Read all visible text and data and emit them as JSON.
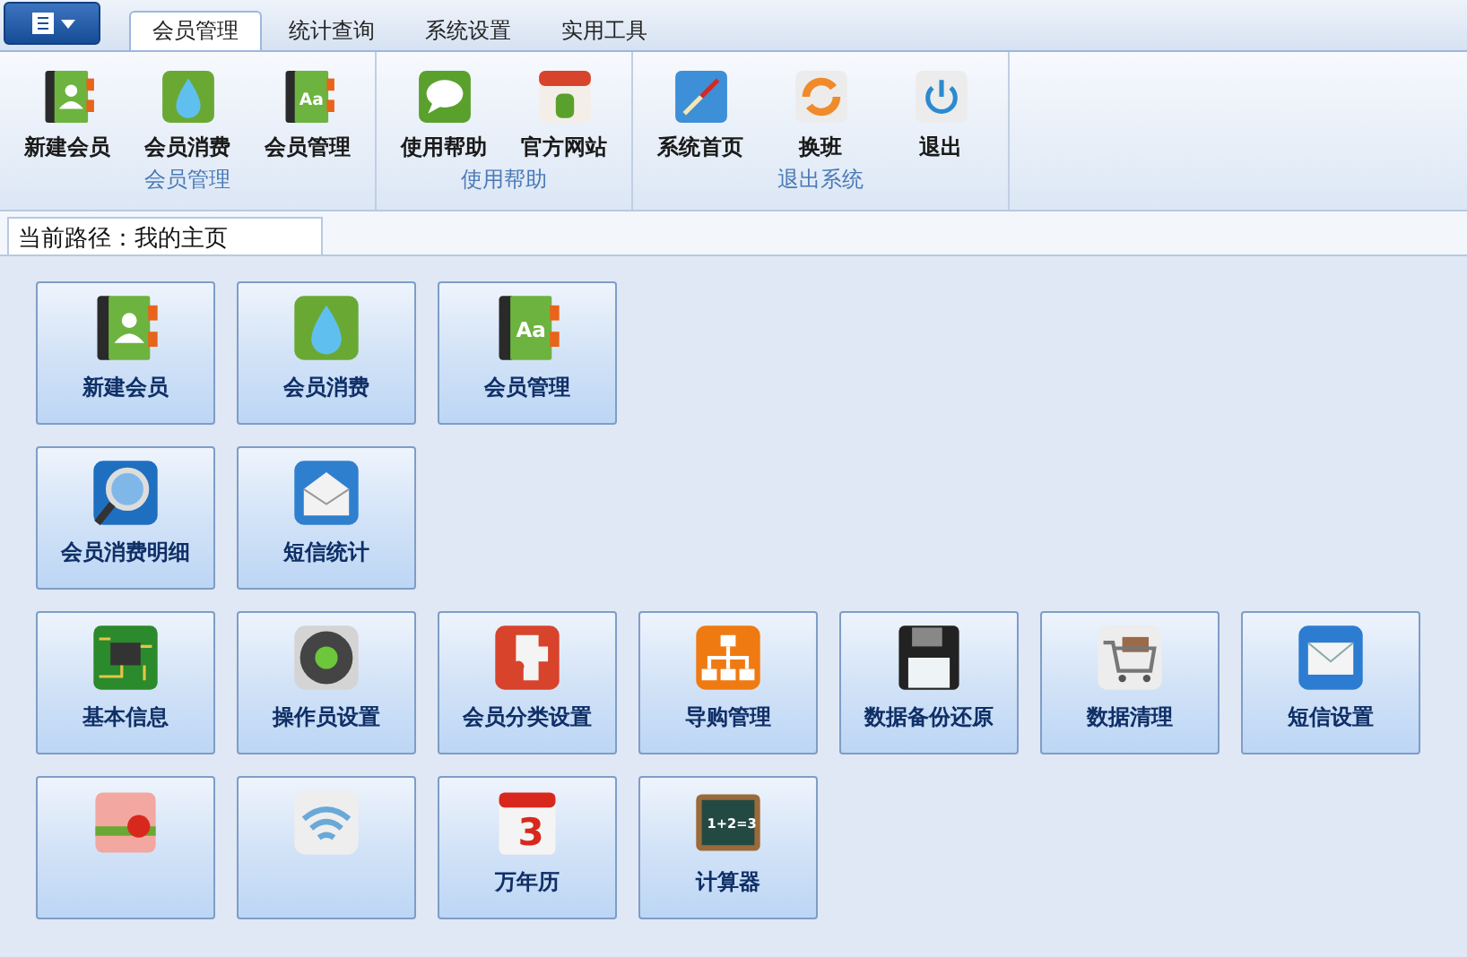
{
  "menu_button": {
    "kind": "list"
  },
  "tabs": [
    {
      "label": "会员管理",
      "selected": true
    },
    {
      "label": "统计查询",
      "selected": false
    },
    {
      "label": "系统设置",
      "selected": false
    },
    {
      "label": "实用工具",
      "selected": false
    }
  ],
  "ribbon_groups": [
    {
      "title": "会员管理",
      "buttons": [
        {
          "label": "新建会员",
          "kind": "contact"
        },
        {
          "label": "会员消费",
          "kind": "water"
        },
        {
          "label": "会员管理",
          "kind": "bookaa",
          "icon_text": "Aa"
        }
      ]
    },
    {
      "title": "使用帮助",
      "buttons": [
        {
          "label": "使用帮助",
          "kind": "chat"
        },
        {
          "label": "官方网站",
          "kind": "shop"
        }
      ]
    },
    {
      "title": "退出系统",
      "buttons": [
        {
          "label": "系统首页",
          "kind": "compass"
        },
        {
          "label": "换班",
          "kind": "swap"
        },
        {
          "label": "退出",
          "kind": "power"
        }
      ]
    }
  ],
  "breadcrumb": {
    "label": "当前路径：我的主页"
  },
  "tile_rows": [
    [
      {
        "label": "新建会员",
        "kind": "contact"
      },
      {
        "label": "会员消费",
        "kind": "water"
      },
      {
        "label": "会员管理",
        "kind": "bookaa",
        "icon_text": "Aa"
      }
    ],
    [
      {
        "label": "会员消费明细",
        "kind": "magnifier"
      },
      {
        "label": "短信统计",
        "kind": "mailopen"
      }
    ],
    [
      {
        "label": "基本信息",
        "kind": "chip"
      },
      {
        "label": "操作员设置",
        "kind": "dpad"
      },
      {
        "label": "会员分类设置",
        "kind": "puzzle"
      },
      {
        "label": "导购管理",
        "kind": "flowchart"
      },
      {
        "label": "数据备份还原",
        "kind": "floppy"
      },
      {
        "label": "数据清理",
        "kind": "cart"
      },
      {
        "label": "短信设置",
        "kind": "envelope"
      }
    ],
    [
      {
        "kind": "gift"
      },
      {
        "kind": "wifi"
      },
      {
        "label": "万年历",
        "kind": "calendar",
        "icon_text": "3"
      },
      {
        "label": "计算器",
        "kind": "chalkboard",
        "icon_text": "1+2=3"
      }
    ]
  ]
}
